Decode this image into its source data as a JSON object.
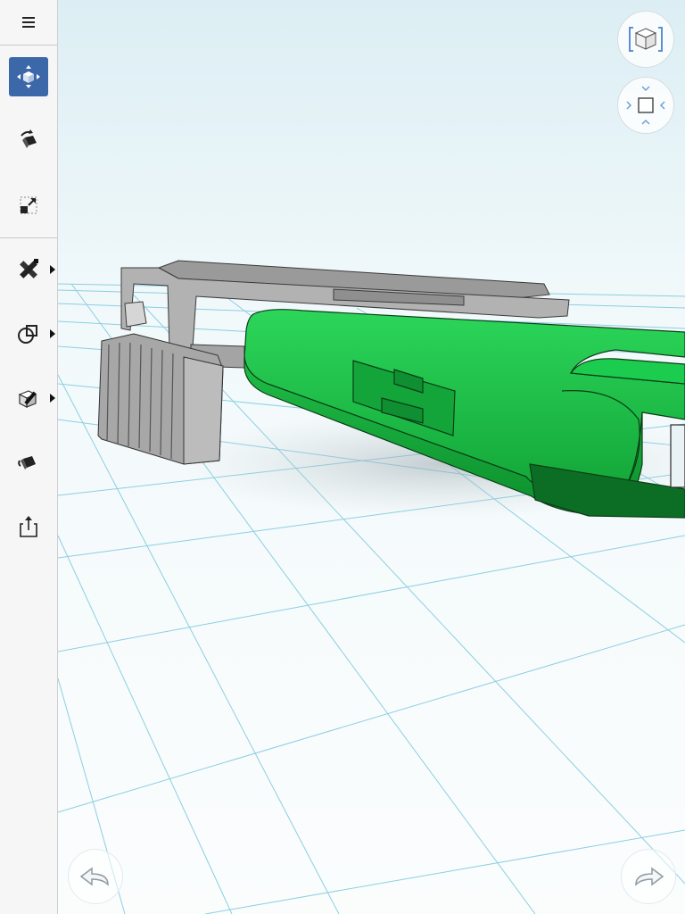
{
  "sidebar": {
    "items": [
      {
        "name": "menu",
        "icon": "hamburger-menu-icon",
        "active": false
      },
      {
        "name": "move",
        "icon": "move-icon",
        "active": true
      },
      {
        "name": "rotate",
        "icon": "rotate-icon",
        "active": false
      },
      {
        "name": "scale",
        "icon": "scale-icon",
        "active": false
      },
      {
        "name": "sketch-tools",
        "icon": "pencil-ruler-icon",
        "active": false,
        "flyout": true
      },
      {
        "name": "combine-tools",
        "icon": "shapes-icon",
        "active": false,
        "flyout": true
      },
      {
        "name": "edit-body",
        "icon": "edit-body-icon",
        "active": false,
        "flyout": true
      },
      {
        "name": "appearance",
        "icon": "paint-bucket-icon",
        "active": false
      },
      {
        "name": "export",
        "icon": "share-icon",
        "active": false
      }
    ],
    "active_color": "#3c67a8"
  },
  "view_controls": {
    "view_cube_icon": "view-cube-icon",
    "orbit_icon": "orbit-square-icon"
  },
  "history": {
    "undo_icon": "undo-arrow-icon",
    "redo_icon": "redo-arrow-icon"
  },
  "colors": {
    "model_green": "#18b33e",
    "model_grey": "#a9a9a9",
    "grid_line": "#7fc7dd",
    "background_top": "#dff0f5"
  }
}
